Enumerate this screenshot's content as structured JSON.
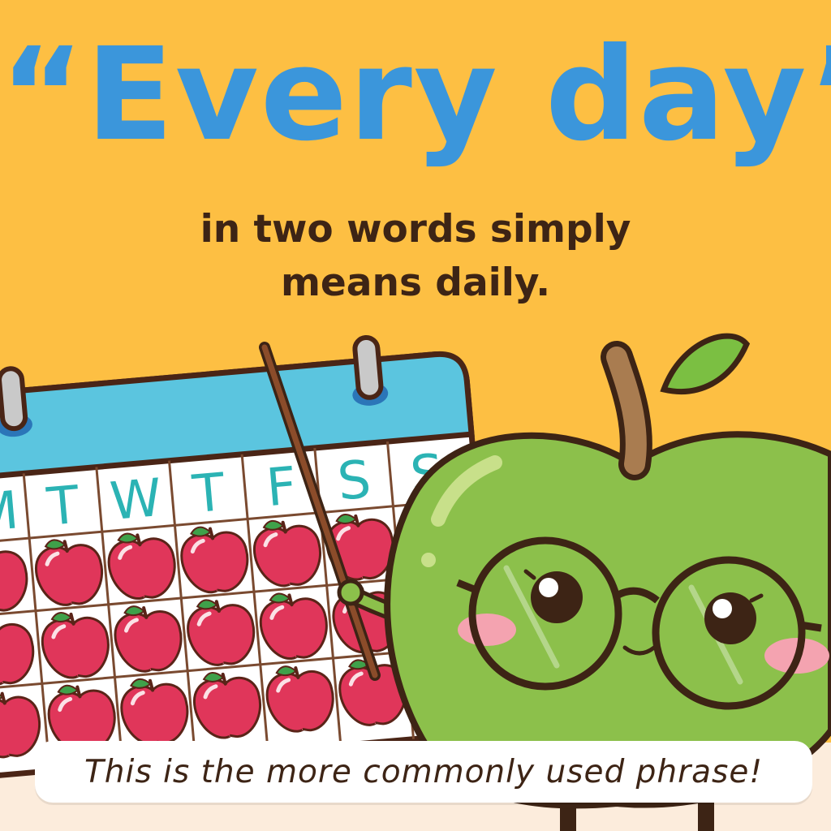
{
  "headline": "“Every day”",
  "subline_lines": [
    "in two words simply",
    "means daily."
  ],
  "caption": "This is the more commonly used phrase!",
  "calendar": {
    "weekdays": [
      "M",
      "T",
      "W",
      "T",
      "F",
      "S",
      "S"
    ]
  },
  "colors": {
    "background": "#fdbf43",
    "headline": "#3b96db",
    "text": "#3d2415",
    "calendar_header": "#5bc5df",
    "weekday_letters": "#2bb3b4",
    "apple_red": "#e0365a",
    "mascot_green": "#8cc04b"
  },
  "icons": {
    "calendar": "calendar-icon",
    "apple": "apple-icon",
    "mascot": "green-apple-mascot-icon",
    "pointer": "pointer-stick-icon"
  }
}
